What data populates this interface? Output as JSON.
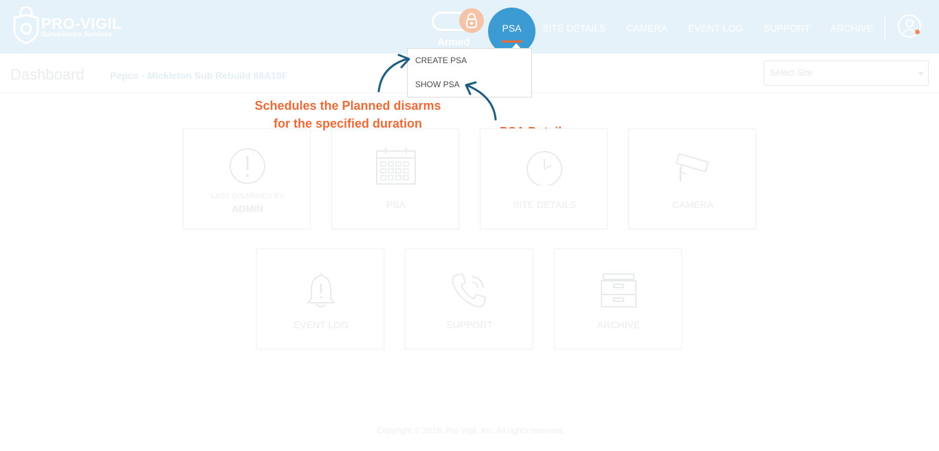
{
  "header": {
    "logo_title": "PRO-VIGIL",
    "logo_subtitle": "Surveillance Services",
    "armed_label": "Armed",
    "psa_label": "PSA",
    "nav": [
      "SITE DETAILS",
      "CAMERA",
      "EVENT LOG",
      "SUPPORT",
      "ARCHIVE"
    ]
  },
  "subheader": {
    "title": "Dashboard",
    "site_name": "Pepco - Mickleton Sub Rebuild 68A10F",
    "select_placeholder": "Select Site"
  },
  "dropdown": {
    "items": [
      "CREATE PSA",
      "SHOW PSA"
    ]
  },
  "annotations": {
    "create_line1": "Schedules the Planned disarms",
    "create_line2": "for the specified duration",
    "show": "PSA Details"
  },
  "cards": {
    "last_disarmed_label": "LAST DISARMED BY",
    "last_disarmed_user": "ADMIN",
    "psa": "PSA",
    "site_details": "SITE DETAILS",
    "camera": "CAMERA",
    "event_log": "EVENT LOG",
    "support": "SUPPORT",
    "archive": "ARCHIVE"
  },
  "footer": "Copyright © 2019. Pro-Vigil, Inc. All rights reserved",
  "colors": {
    "header_bg": "#e6f2f9",
    "accent_blue": "#3d9bd4",
    "accent_orange": "#ea6b38",
    "arrow_blue": "#1e5d80"
  },
  "icons": [
    "shield-lock-logo",
    "lock-icon",
    "user-icon",
    "exclamation-icon",
    "calendar-icon",
    "clock-icon",
    "cctv-camera-icon",
    "bell-alert-icon",
    "phone-icon",
    "archive-box-icon"
  ]
}
